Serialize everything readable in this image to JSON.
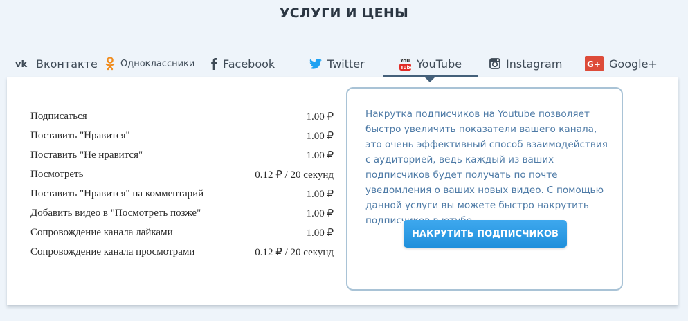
{
  "page": {
    "title": "УСЛУГИ И ЦЕНЫ"
  },
  "tabs": [
    {
      "label": "Вконтакте",
      "icon": "vk-icon"
    },
    {
      "label": "Одноклассники",
      "icon": "odnoklassniki-icon"
    },
    {
      "label": "Facebook",
      "icon": "facebook-icon"
    },
    {
      "label": "Twitter",
      "icon": "twitter-icon"
    },
    {
      "label": "YouTube",
      "icon": "youtube-icon",
      "active": true
    },
    {
      "label": "Instagram",
      "icon": "instagram-icon"
    },
    {
      "label": "Google+",
      "icon": "google-plus-icon"
    }
  ],
  "prices": [
    {
      "service": "Подписаться",
      "price": "1.00 ₽"
    },
    {
      "service": "Поставить \"Нравится\"",
      "price": "1.00 ₽"
    },
    {
      "service": "Поставить \"Не нравится\"",
      "price": "1.00 ₽"
    },
    {
      "service": "Посмотреть",
      "price": "0.12 ₽ / 20 секунд"
    },
    {
      "service": "Поставить \"Нравится\" на комментарий",
      "price": "1.00 ₽"
    },
    {
      "service": "Добавить видео в \"Посмотреть позже\"",
      "price": "1.00 ₽"
    },
    {
      "service": "Сопровождение канала лайками",
      "price": "1.00 ₽"
    },
    {
      "service": "Сопровождение канала просмотрами",
      "price": "0.12 ₽ / 20 секунд"
    }
  ],
  "info": {
    "text": "Накрутка подписчиков на Youtube позволяет быстро увеличить показатели вашего канала, это очень эффективный способ взаимодействия с аудиторией, ведь каждый из ваших подписчиков будет получать по почте уведомления о ваших новых видео. С помощью данной услуги вы можете быстро накрутить подписчиков в ютубе",
    "button_label": "НАКРУТИТЬ ПОДПИСЧИКОВ"
  },
  "colors": {
    "accent": "#1f8fdb",
    "info_text": "#4d7aa6",
    "tab_active_underline": "#44607a",
    "youtube": "#e22b26",
    "odnoklassniki": "#f08c1e",
    "google_plus": "#dd4b39",
    "vk": "#3e4a56"
  }
}
